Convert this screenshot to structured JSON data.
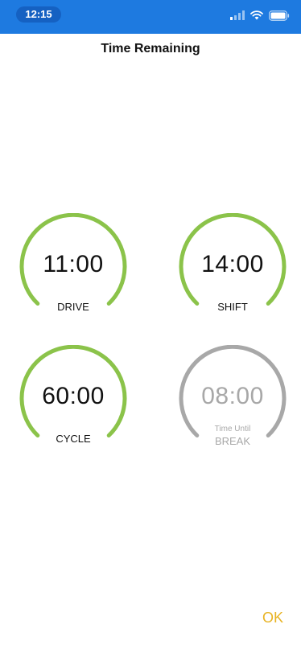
{
  "status_bar": {
    "time": "12:15",
    "icons": [
      "signal-icon",
      "wifi-icon",
      "battery-icon"
    ]
  },
  "header": {
    "title": "Time Remaining"
  },
  "gauges": {
    "drive": {
      "value": "11:00",
      "label": "DRIVE",
      "color": "#8bc34a"
    },
    "shift": {
      "value": "14:00",
      "label": "SHIFT",
      "color": "#8bc34a"
    },
    "cycle": {
      "value": "60:00",
      "label": "CYCLE",
      "color": "#8bc34a"
    },
    "break": {
      "value": "08:00",
      "sublabel": "Time Until",
      "label": "BREAK",
      "color": "#a8a8a8"
    }
  },
  "footer": {
    "ok_label": "OK",
    "ok_color": "#e8b323"
  }
}
